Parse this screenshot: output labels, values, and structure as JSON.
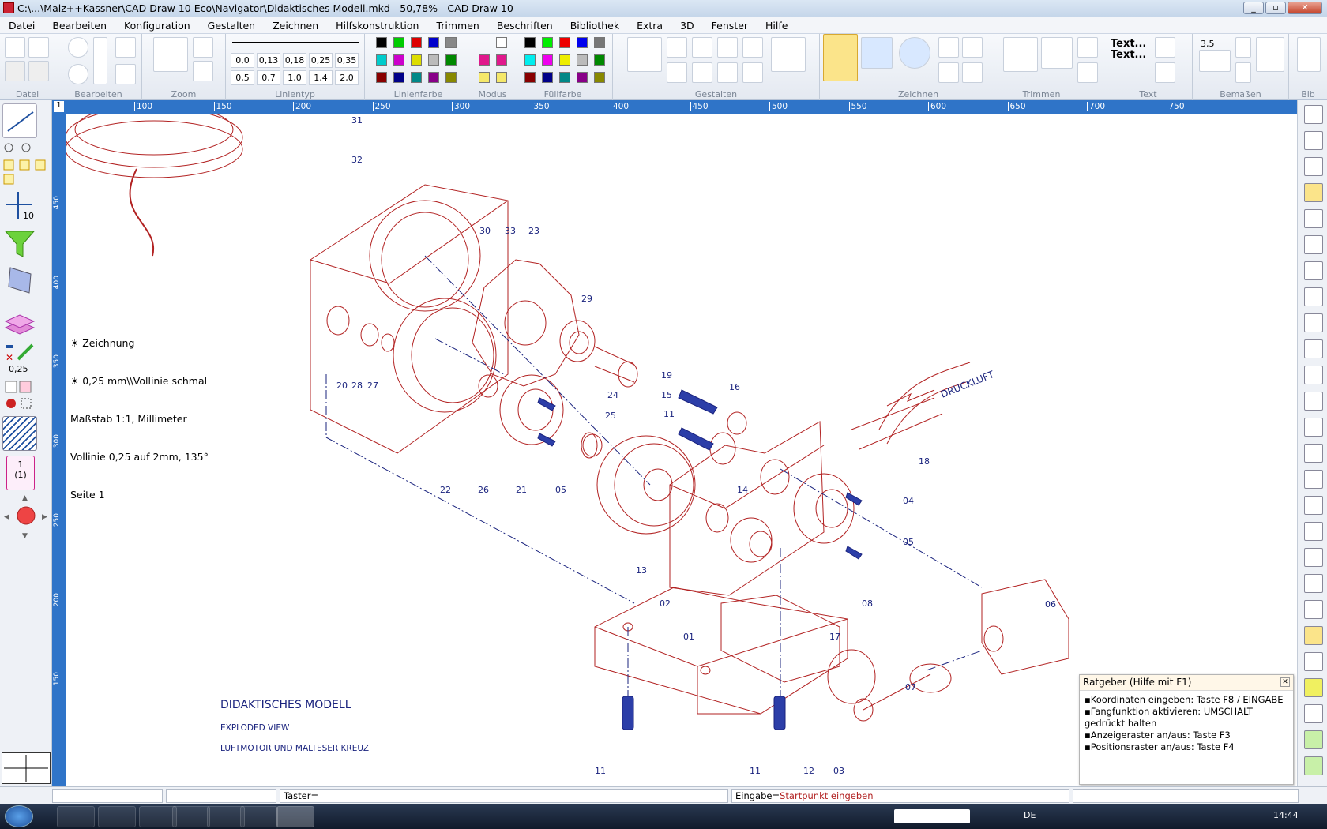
{
  "window": {
    "title": "C:\\...\\Malz++Kassner\\CAD Draw 10 Eco\\Navigator\\Didaktisches Modell.mkd - 50,78% - CAD Draw 10"
  },
  "menu": [
    "Datei",
    "Bearbeiten",
    "Konfiguration",
    "Gestalten",
    "Zeichnen",
    "Hilfskonstruktion",
    "Trimmen",
    "Beschriften",
    "Bibliothek",
    "Extra",
    "3D",
    "Fenster",
    "Hilfe"
  ],
  "toolbar": {
    "groups": [
      "Datei",
      "Bearbeiten",
      "Zoom",
      "Linientyp",
      "Linienfarbe",
      "Modus",
      "Füllfarbe",
      "Gestalten",
      "Zeichnen",
      "Trimmen",
      "Text",
      "Bemaßen",
      "Bib"
    ],
    "line_widths": [
      "0,0",
      "0,13",
      "0,18",
      "0,25",
      "0,35",
      "0,5",
      "0,7",
      "1,0",
      "1,4",
      "2,0"
    ],
    "line_colors": [
      "#000000",
      "#00cc00",
      "#dd0000",
      "#0000cc",
      "#888888",
      "#00cccc",
      "#cc00cc",
      "#dddd00",
      "#bbbbbb",
      "#008800",
      "#880000",
      "#000088",
      "#008888",
      "#880088",
      "#888800"
    ],
    "fill_colors": [
      "#000000",
      "#00ee00",
      "#ee0000",
      "#0000ee",
      "#777777",
      "#00eeee",
      "#ee00ee",
      "#eeee00",
      "#bbbbbb",
      "#008800",
      "#880000",
      "#000088",
      "#008888",
      "#880088",
      "#888800"
    ],
    "text_btn": "Text...\nText...",
    "dim_value": "3,5"
  },
  "ruler": {
    "top_ticks": [
      "100",
      "150",
      "200",
      "250",
      "300",
      "350",
      "400",
      "450",
      "500",
      "550",
      "600",
      "650",
      "700",
      "750"
    ],
    "left_ticks": [
      "450",
      "400",
      "350",
      "300",
      "250",
      "200",
      "150"
    ],
    "corner": "1"
  },
  "left_panel": {
    "snap_count": "10",
    "line_width": "0,25",
    "page": "1",
    "page_sub": "(1)"
  },
  "info": {
    "layer": "Zeichnung",
    "pen": "0,25 mm\\\\Vollinie schmal",
    "scale": "Maßstab 1:1, Millimeter",
    "hatch": "Vollinie 0,25 auf 2mm, 135°",
    "page": "Seite 1"
  },
  "drawing": {
    "title": "DIDAKTISCHES MODELL",
    "sub1": "EXPLODED VIEW",
    "sub2": "LUFTMOTOR UND MALTESER KREUZ",
    "arrow_text": "DRUCKLUFT",
    "labels": [
      "31",
      "32",
      "30",
      "33",
      "23",
      "29",
      "20",
      "28",
      "27",
      "19",
      "24",
      "15",
      "16",
      "11",
      "25",
      "22",
      "26",
      "21",
      "05",
      "18",
      "14",
      "04",
      "05",
      "13",
      "02",
      "08",
      "06",
      "01",
      "17",
      "07",
      "11",
      "11",
      "12",
      "03"
    ]
  },
  "help": {
    "title": "Ratgeber (Hilfe mit F1)",
    "items": [
      "Koordinaten eingeben: Taste F8 / EINGABE",
      "Fangfunktion aktivieren: UMSCHALT gedrückt halten",
      "Anzeigeraster an/aus: Taste F3",
      "Positionsraster an/aus: Taste F4"
    ]
  },
  "status": {
    "taster": "Taster=",
    "eingabe_label": "Eingabe=",
    "eingabe_value": "Startpunkt eingeben"
  },
  "taskbar": {
    "lang": "DE",
    "time": "14:44"
  },
  "colors": {
    "drawing": "#b22222",
    "blue": "#1a237e",
    "ruler": "#2f74c8"
  }
}
